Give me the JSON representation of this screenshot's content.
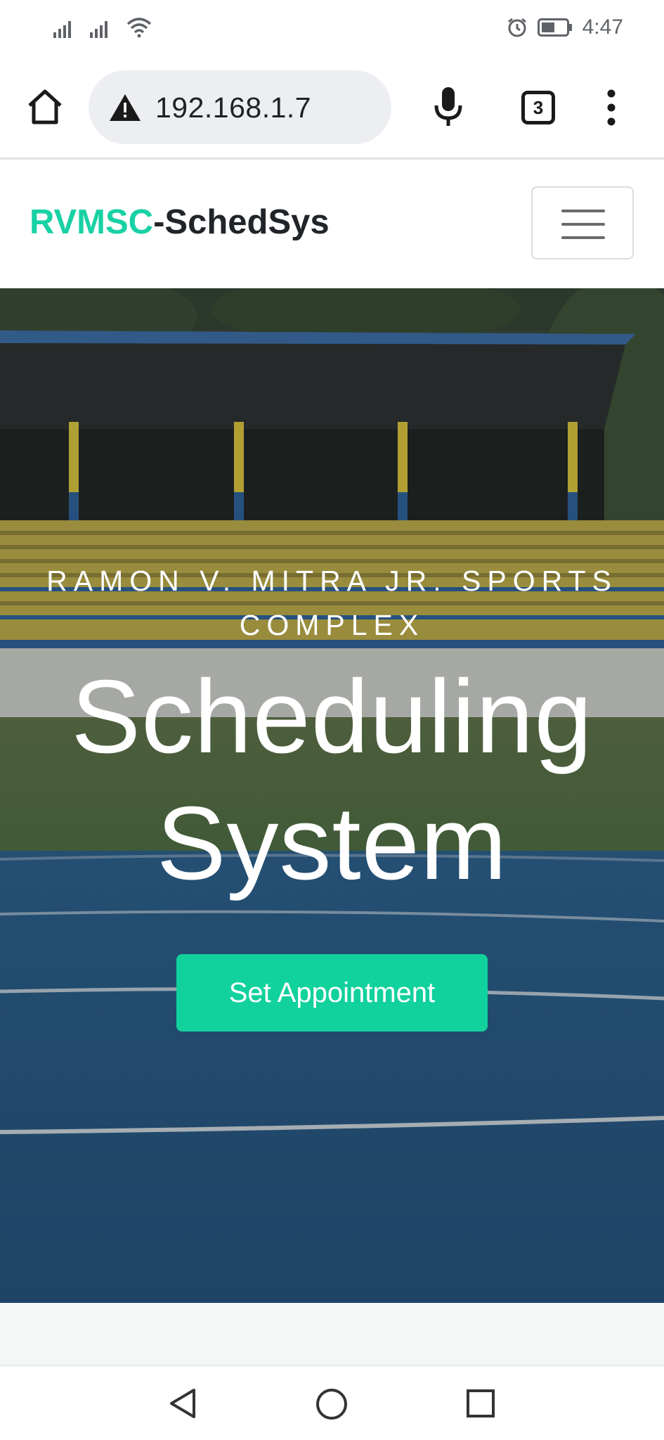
{
  "status_bar": {
    "time": "4:47",
    "icons": [
      "signal-icon",
      "signal-icon",
      "wifi-icon",
      "alarm-icon",
      "battery-icon"
    ]
  },
  "browser": {
    "url": "192.168.1.7",
    "tab_count": "3",
    "icons": [
      "home-icon",
      "warning-icon",
      "microphone-icon",
      "tab-switcher-icon",
      "overflow-menu-icon"
    ]
  },
  "navbar": {
    "brand_accent": "RVMSC",
    "brand_rest": "-SchedSys",
    "toggler_icon": "hamburger-icon"
  },
  "hero": {
    "subtitle": "RAMON V. MITRA JR. SPORTS COMPLEX",
    "title": "Scheduling System",
    "cta_label": "Set Appointment"
  },
  "android_nav": {
    "icons": [
      "back-icon",
      "home-circle-icon",
      "recents-icon"
    ]
  },
  "colors": {
    "accent": "#18d1a4",
    "button": "#11d19d",
    "dark_text": "#212529"
  }
}
